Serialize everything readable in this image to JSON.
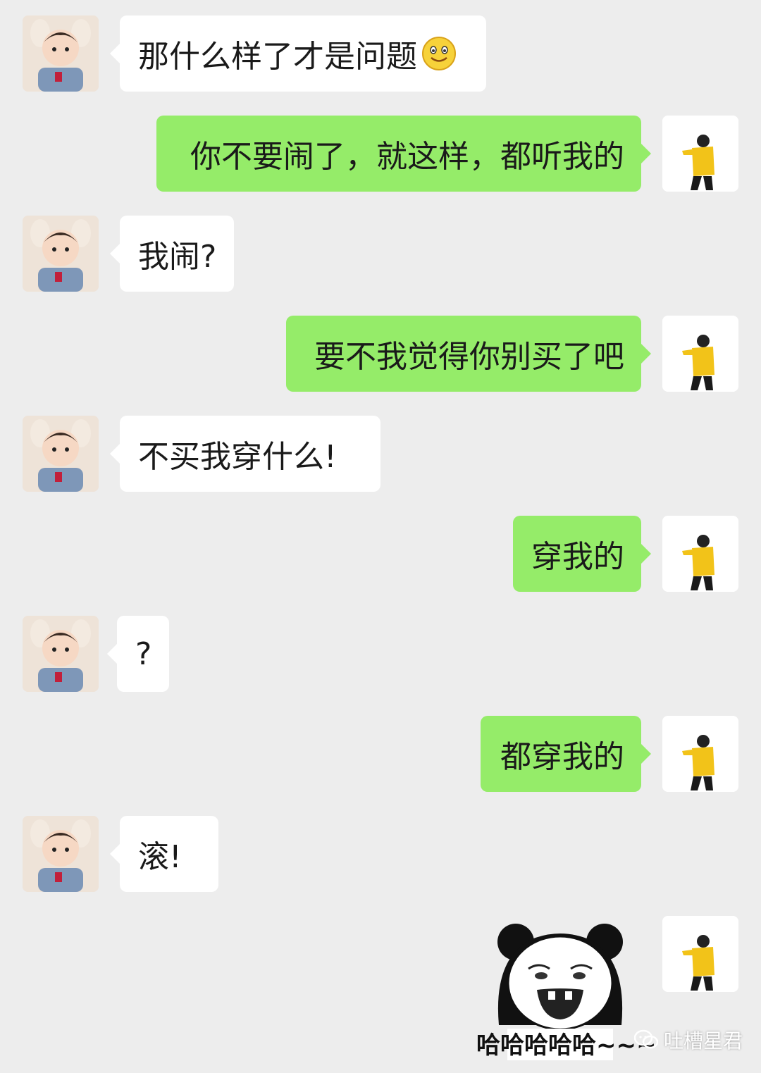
{
  "messages": [
    {
      "side": "in",
      "text": "那什么样了才是问题",
      "emoji": "smile"
    },
    {
      "side": "out",
      "text": "你不要闹了，就这样，都听我的"
    },
    {
      "side": "in",
      "text": "我闹?"
    },
    {
      "side": "out",
      "text": "要不我觉得你别买了吧"
    },
    {
      "side": "in",
      "text": "不买我穿什么!"
    },
    {
      "side": "out",
      "text": "穿我的"
    },
    {
      "side": "in",
      "text": "?"
    },
    {
      "side": "out",
      "text": "都穿我的"
    },
    {
      "side": "in",
      "text": "滚!"
    }
  ],
  "sticker": {
    "caption": "哈哈哈哈哈~~~",
    "icon": "panda-laughing-sticker"
  },
  "watermark": {
    "label": "吐槽星君",
    "icon": "wechat-icon"
  },
  "colors": {
    "background": "#ededed",
    "incoming_bubble": "#ffffff",
    "outgoing_bubble": "#95ec69"
  }
}
